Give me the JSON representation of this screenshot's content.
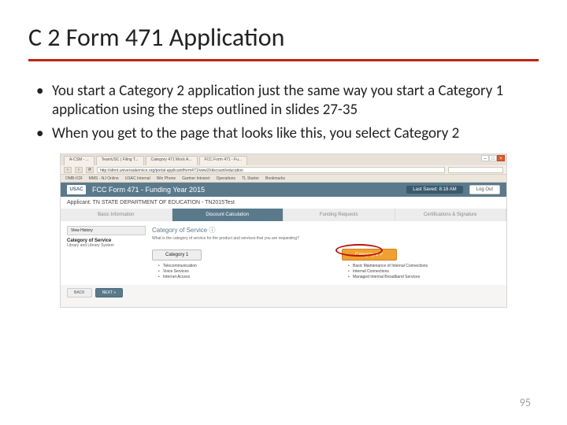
{
  "title": "C 2 Form 471 Application",
  "bullets": [
    "You start a Category 2 application just the same way you start a Category 1 application using the steps outlined in slides 27-35",
    "When you get to the page that looks like this, you select Category 2"
  ],
  "browser": {
    "tabs": [
      "A-CSM - ...",
      "TeamUSC | Filing T...",
      "Category 471 Mock A...",
      "FCC Form 471 - Fu..."
    ],
    "url": "http://sltrnt.universalservice.org/portal-applicant/form471/view2/discount/education",
    "bookmarks": [
      "OMB-ICR",
      "MMS - NJ Online",
      "USAC Internal",
      "Win Phone",
      "Gartner Intranet",
      "Operations",
      "TL Starter",
      "Bookmarks"
    ]
  },
  "app": {
    "usac": "USAC",
    "header_title": "FCC Form 471 - Funding Year 2015",
    "last_saved": "Last Saved: 8:18 AM",
    "logout": "Log Out",
    "applicant_label": "Applicant: TN STATE DEPARTMENT OF EDUCATION - TN2015Test",
    "wizard": [
      "Basic Information",
      "Discount Calculation",
      "Funding Requests",
      "Certifications & Signature"
    ],
    "sidebar_btn": "View History",
    "sidebar_label": "Category of Service",
    "sidebar_sub": "Library and Library System",
    "main_title": "Category of Service ⓘ",
    "main_sub": "What is the category of service for the product and services that you are requesting?",
    "cat1": {
      "label": "Category 1",
      "items": [
        "Telecommunication",
        "Voice Services",
        "Internet Access"
      ]
    },
    "cat2": {
      "label": "Category 2 ✓",
      "items": [
        "Basic Maintenance of Internal Connections",
        "Internal Connections",
        "Managed Internal Broadband Services"
      ]
    },
    "back": "BACK",
    "next": "NEXT »"
  },
  "page_number": "95"
}
